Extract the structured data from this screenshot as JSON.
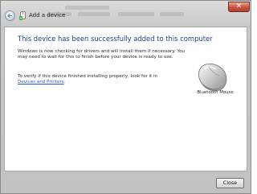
{
  "window": {
    "title": "Add a device",
    "close_glyph": "✕"
  },
  "icons": {
    "back": "back-arrow-icon",
    "title": "device-icon",
    "device": "mouse-icon"
  },
  "content": {
    "heading": "This device has been successfully added to this computer",
    "paragraph1": "Windows is now checking for drivers and will install them if necessary. You may need to wait for this to finish before your device is ready to use.",
    "paragraph2_text": "To verify if this device finished installing properly, look for it in",
    "paragraph2_link": "Devices and Printers",
    "paragraph2_suffix": ".",
    "device_label": "Bluetooth Mouse"
  },
  "footer": {
    "close_label": "Close"
  },
  "colors": {
    "heading": "#1e3f8f",
    "link": "#2a56c6",
    "close_button": "#c9533f"
  }
}
